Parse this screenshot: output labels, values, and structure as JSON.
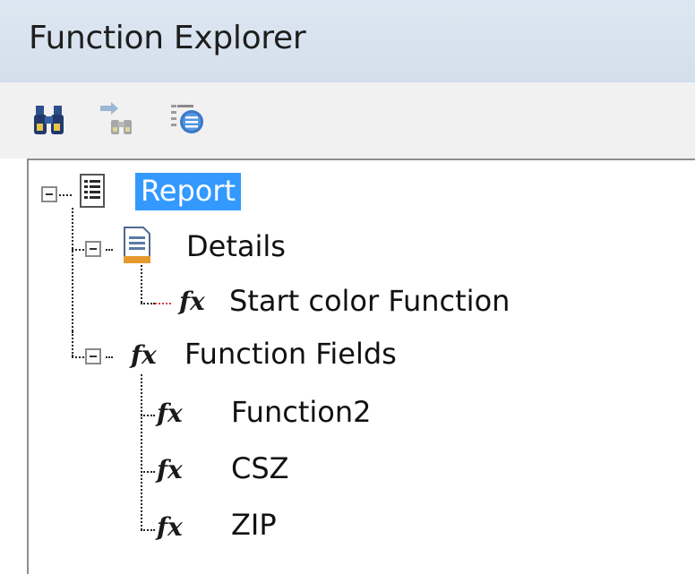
{
  "panel": {
    "title": "Function Explorer"
  },
  "toolbar": {
    "buttons": [
      {
        "icon": "binoculars-find-icon"
      },
      {
        "icon": "find-next-icon"
      },
      {
        "icon": "properties-list-icon"
      }
    ]
  },
  "tree": {
    "root": {
      "label": "Report",
      "icon": "report-document-icon",
      "selected": true
    },
    "details": {
      "label": "Details",
      "icon": "details-section-icon"
    },
    "start_color": {
      "label": "Start color Function",
      "icon": "fx-icon"
    },
    "function_fields": {
      "label": "Function Fields",
      "icon": "fx-icon"
    },
    "function2": {
      "label": "Function2",
      "icon": "fx-icon"
    },
    "csz": {
      "label": "CSZ",
      "icon": "fx-icon"
    },
    "zip": {
      "label": "ZIP",
      "icon": "fx-icon"
    }
  },
  "colors": {
    "selection": "#3399ff",
    "title_bar": "#d8e3ef",
    "toolbar": "#f1f1f1"
  }
}
